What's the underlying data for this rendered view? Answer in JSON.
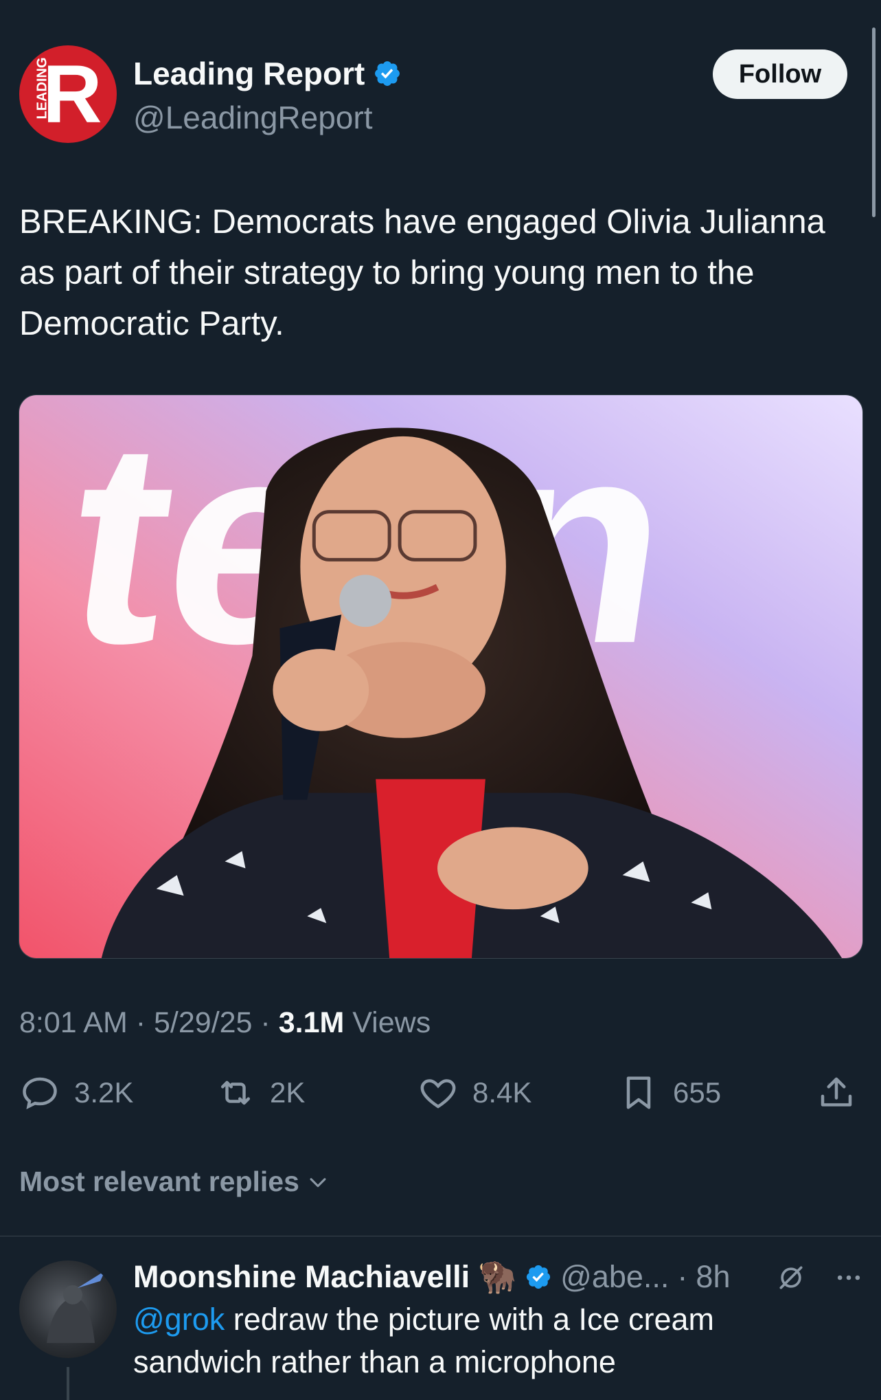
{
  "account": {
    "name": "Leading Report",
    "handle": "@LeadingReport",
    "logo_letter": "R",
    "logo_vertical_text": "LEADING",
    "verified": true
  },
  "follow_label": "Follow",
  "tweet": {
    "text": "BREAKING: Democrats have engaged Olivia Julianna as part of their strategy to bring young men to the Democratic Party.",
    "time": "8:01 AM",
    "date": "5/29/25",
    "views_count": "3.1M",
    "views_label": "Views",
    "meta_separator": "·"
  },
  "media": {
    "icon": "photo",
    "background_text": "teen"
  },
  "actions": {
    "replies": "3.2K",
    "reposts": "2K",
    "likes": "8.4K",
    "bookmarks": "655"
  },
  "replies_sort_label": "Most relevant replies",
  "reply": {
    "name": "Moonshine Machiavelli",
    "emoji": "🦬",
    "handle": "@abe...",
    "separator": "·",
    "time": "8h",
    "mention": "@grok",
    "text": " redraw the picture with a Ice cream sandwich rather than a microphone"
  },
  "colors": {
    "background": "#15202b",
    "text_primary": "#f7f9f9",
    "text_secondary": "#8b98a5",
    "accent": "#1d9bf0",
    "logo_red": "#d21f2a",
    "follow_bg": "#eff3f4"
  }
}
